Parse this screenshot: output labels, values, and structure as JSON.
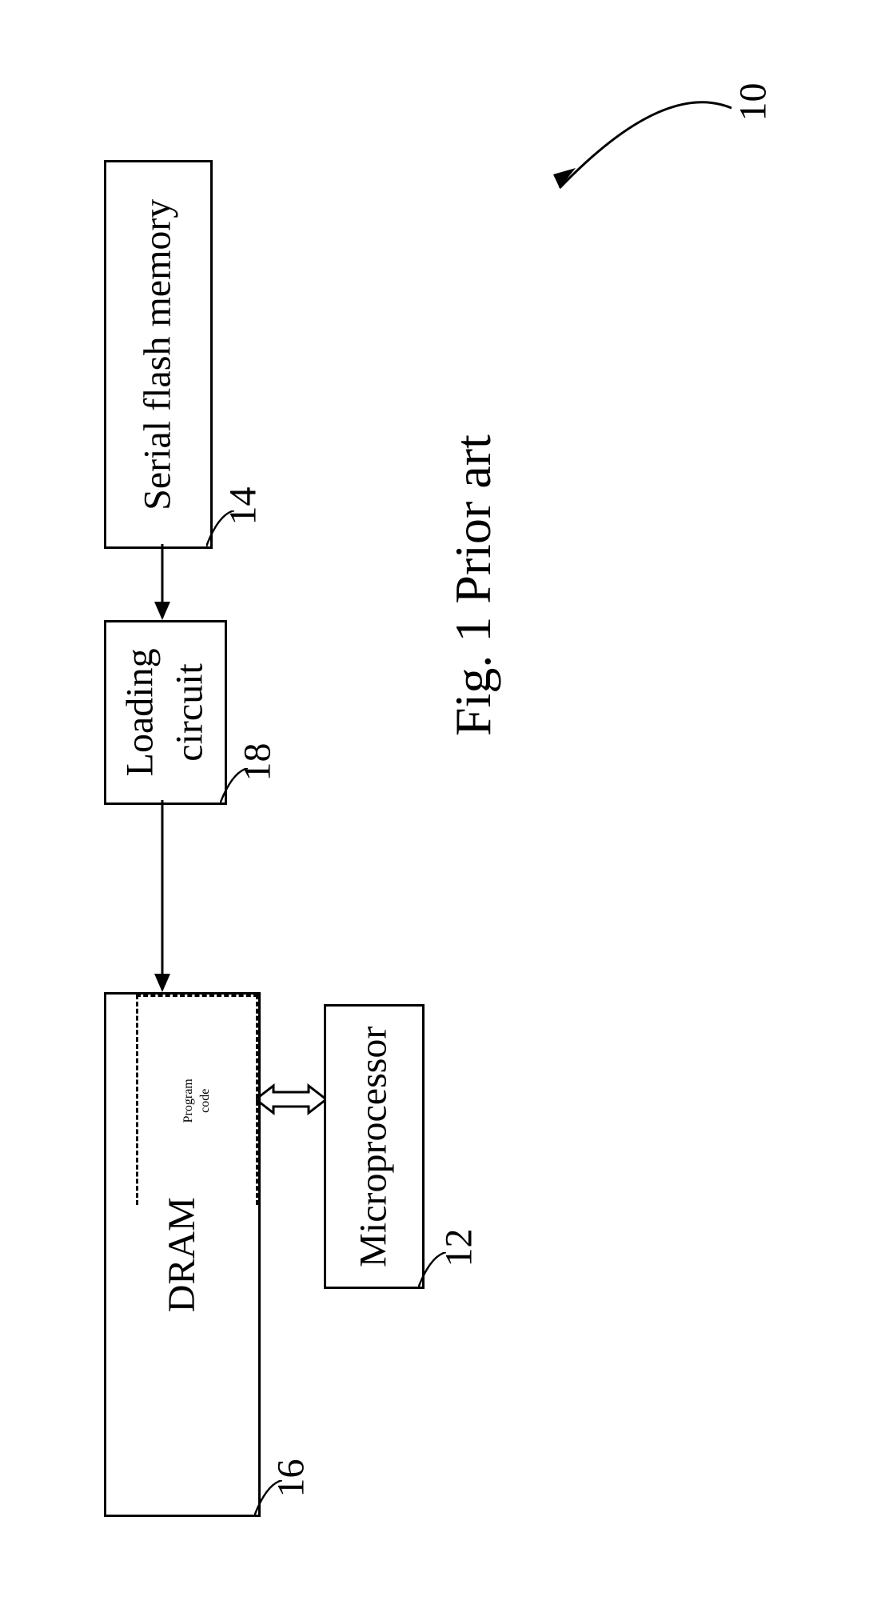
{
  "blocks": {
    "dram": {
      "label": "DRAM",
      "ref": "16"
    },
    "program_code": {
      "label_line1": "Program",
      "label_line2": "code"
    },
    "microprocessor": {
      "label": "Microprocessor",
      "ref": "12"
    },
    "loading_circuit": {
      "label_line1": "Loading",
      "label_line2": "circuit",
      "ref": "18"
    },
    "serial_flash": {
      "label": "Serial flash memory",
      "ref": "14"
    }
  },
  "system_ref": "10",
  "caption": "Fig. 1 Prior art"
}
